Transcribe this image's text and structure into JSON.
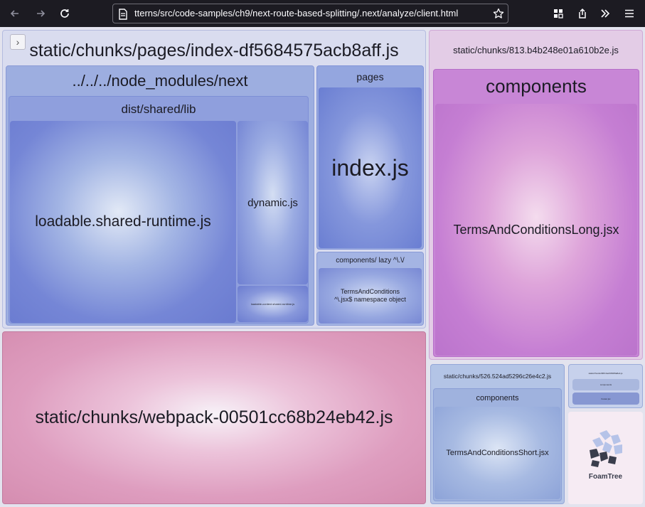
{
  "browser": {
    "url": "tterns/src/code-samples/ch9/next-route-based-splitting/.next/analyze/client.html",
    "icons": [
      "back-arrow-icon",
      "forward-arrow-icon",
      "reload-icon",
      "document-icon",
      "bookmark-star-icon",
      "extensions-icon",
      "share-icon",
      "overflow-chevrons-icon",
      "menu-icon"
    ]
  },
  "treemap": {
    "sidebar_toggle": "›",
    "index_chunk": {
      "label": "static/chunks/pages/index-df5684575acb8aff.js",
      "node_modules": {
        "label": "../../../node_modules/next",
        "dist": {
          "label": "dist/shared/lib",
          "loadable": "loadable.shared-runtime.js",
          "dynamic": "dynamic.js",
          "tiny": "loadable-context.shared-runtime.js"
        }
      },
      "pages": {
        "label": "pages",
        "index": "index.js"
      },
      "lazy": {
        "label": "components/ lazy ^\\.\\/",
        "namespace": "TermsAndConditions ^\\.jsx$ namespace object"
      }
    },
    "webpack_chunk": {
      "label": "static/chunks/webpack-00501cc68b24eb42.js"
    },
    "chunk_813": {
      "label": "static/chunks/813.b4b248e01a610b2e.js",
      "components": {
        "label": "components",
        "long": "TermsAndConditionsLong.jsx"
      }
    },
    "chunk_526": {
      "label": "static/chunks/526.524ad5296c26e4c2.js",
      "components": {
        "label": "components",
        "short": "TermsAndConditionsShort.jsx"
      }
    },
    "small_chunk": {
      "label": "static/chunks/966.0a21660f9a8e4.js",
      "inner": "components",
      "leaf": "Footer.jsx"
    },
    "foamtree": {
      "label": "FoamTree"
    }
  },
  "colors": {
    "browser_chrome": "#1c1b22",
    "index_chunk": "#d9dcef",
    "node_modules": "#9daee0",
    "dist_lib": "#8f9fdd",
    "index_js": "#6a7ed2",
    "webpack_chunk": "#d993b3",
    "chunk_813": "#e3cce6",
    "components_813": "#c27ed2",
    "chunk_526": "#aec1e4",
    "foamtree_logo": "#3a3d4c"
  }
}
